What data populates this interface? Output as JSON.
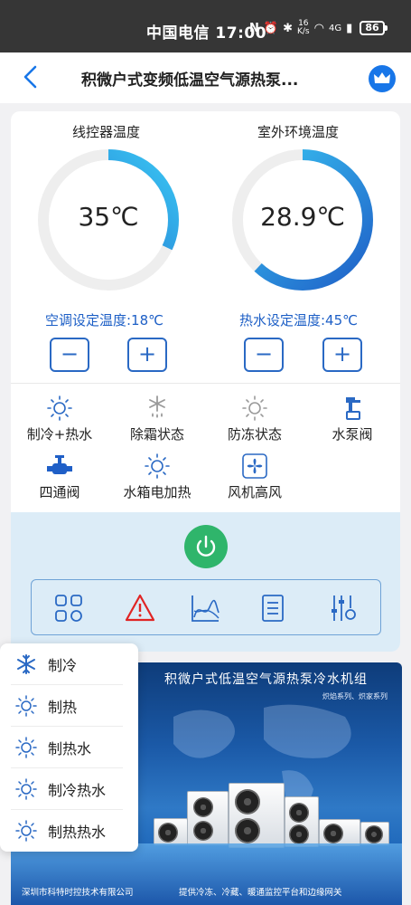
{
  "status_bar": {
    "carrier_time": "中国电信 17:00",
    "network_speed_top": "16",
    "network_speed_unit": "K/s",
    "signal": "4G",
    "battery": "86"
  },
  "header": {
    "title": "积微户式变频低温空气源热泵...",
    "back_icon": "chevron-left-icon",
    "crown_icon": "crown-icon"
  },
  "gauges": [
    {
      "title": "线控器温度",
      "value": "35℃",
      "arc_fraction": 0.32
    },
    {
      "title": "室外环境温度",
      "value": "28.9℃",
      "arc_fraction": 0.62
    }
  ],
  "settings": {
    "ac_label": "空调设定温度:18℃",
    "water_label": "热水设定温度:45℃",
    "minus": "−",
    "plus": "+"
  },
  "status_items": [
    {
      "label": "制冷+热水",
      "icon": "sun-icon"
    },
    {
      "label": "除霜状态",
      "icon": "snowflake-drop-icon"
    },
    {
      "label": "防冻状态",
      "icon": "sun-icon"
    },
    {
      "label": "水泵阀",
      "icon": "pump-valve-icon"
    },
    {
      "label": "四通阀",
      "icon": "four-way-valve-icon"
    },
    {
      "label": "水箱电加热",
      "icon": "sun-icon"
    },
    {
      "label": "风机高风",
      "icon": "fan-icon"
    }
  ],
  "toolbar": [
    {
      "icon": "grid-apps-icon"
    },
    {
      "icon": "alarm-warning-icon"
    },
    {
      "icon": "curve-chart-icon"
    },
    {
      "icon": "document-list-icon"
    },
    {
      "icon": "sliders-settings-icon"
    }
  ],
  "mode_menu": [
    {
      "label": "制冷",
      "icon": "snowflake-icon"
    },
    {
      "label": "制热",
      "icon": "sun-icon"
    },
    {
      "label": "制热水",
      "icon": "sun-icon"
    },
    {
      "label": "制冷热水",
      "icon": "sun-icon"
    },
    {
      "label": "制热热水",
      "icon": "sun-icon"
    }
  ],
  "banner": {
    "title": "积微户式低温空气源热泵冷水机组",
    "subtitle": "炽焰系列、炽家系列",
    "footer_left": "深圳市科特时控技术有限公司",
    "footer_right": "提供冷冻、冷藏、暖通监控平台和边缘网关"
  },
  "colors": {
    "accent": "#1d5fc6",
    "power": "#2fb56b",
    "warning": "#e02424",
    "gauge_start": "#1f5fc7",
    "gauge_end": "#39c6f3"
  }
}
